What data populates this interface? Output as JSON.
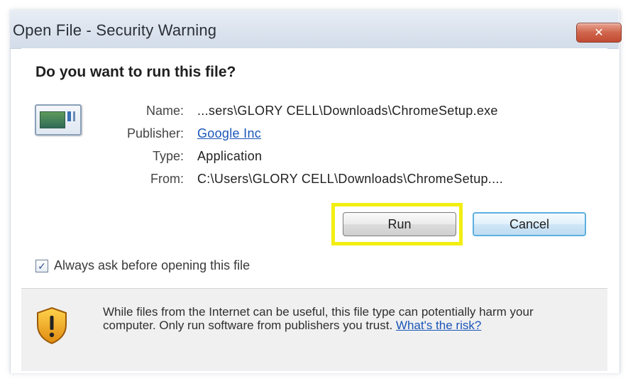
{
  "window": {
    "title": "Open File - Security Warning",
    "close_label": "✕"
  },
  "prompt": {
    "question": "Do you want to run this file?"
  },
  "details": {
    "name_label": "Name:",
    "name_value": "...sers\\GLORY CELL\\Downloads\\ChromeSetup.exe",
    "publisher_label": "Publisher:",
    "publisher_value": "Google Inc",
    "type_label": "Type:",
    "type_value": "Application",
    "from_label": "From:",
    "from_value": "C:\\Users\\GLORY CELL\\Downloads\\ChromeSetup...."
  },
  "buttons": {
    "run_label": "Run",
    "cancel_label": "Cancel"
  },
  "options": {
    "always_ask_label": "Always ask before opening this file",
    "always_ask_checked": true
  },
  "footer": {
    "warning_text": "While files from the Internet can be useful, this file type can potentially harm your computer. Only run software from publishers you trust.",
    "risk_link": "What's the risk?"
  },
  "colors": {
    "highlight": "#f2ee12",
    "link": "#1a55b8",
    "titlebar": "#dbe3ee"
  },
  "icons": {
    "app": "application-icon",
    "shield": "warning-shield-icon",
    "close": "close-icon",
    "check": "checkmark-icon"
  }
}
